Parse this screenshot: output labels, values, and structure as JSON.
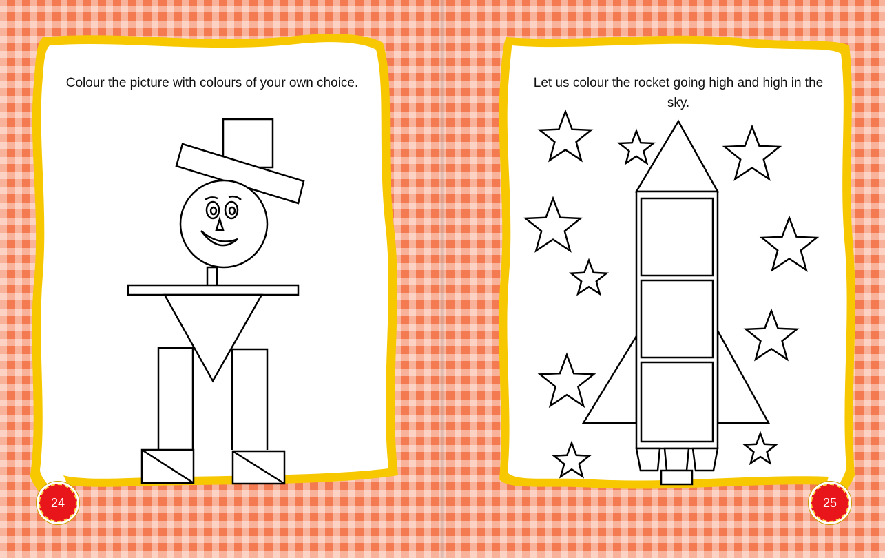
{
  "pages": {
    "left": {
      "instruction": "Colour the picture with colours  of your own choice.",
      "page_number": "24",
      "illustration_icon": "shape-man-with-hat-icon"
    },
    "right": {
      "instruction": "Let us colour the rocket going high and high in the sky.",
      "page_number": "25",
      "illustration_icon": "rocket-with-stars-icon"
    }
  },
  "colors": {
    "background": "#f47a52",
    "frame": "#f7c800",
    "page_badge": "#e8151b",
    "paper": "#ffffff"
  }
}
